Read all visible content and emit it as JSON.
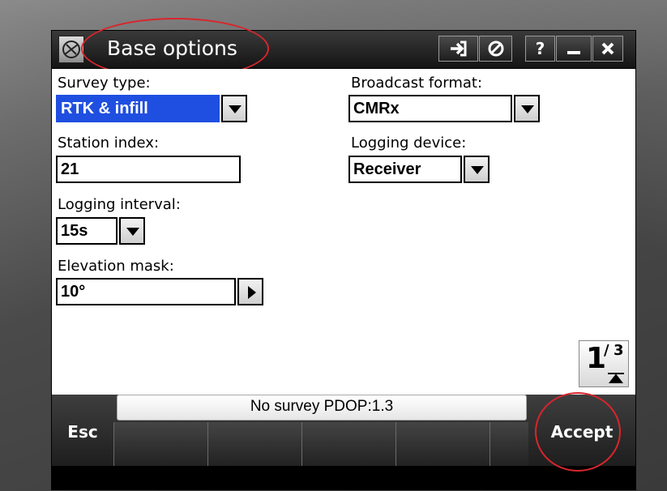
{
  "window": {
    "title": "Base options"
  },
  "titlebar_buttons": {
    "help_label": "?"
  },
  "form": {
    "survey_type": {
      "label": "Survey type:",
      "value": "RTK & infill"
    },
    "station_index": {
      "label": "Station index:",
      "value": "21"
    },
    "logging_interval": {
      "label": "Logging interval:",
      "value": "15s"
    },
    "elevation_mask": {
      "label": "Elevation mask:",
      "value": "10°"
    },
    "broadcast_format": {
      "label": "Broadcast format:",
      "value": "CMRx"
    },
    "logging_device": {
      "label": "Logging device:",
      "value": "Receiver"
    }
  },
  "page_indicator": {
    "current": "1",
    "total": "3"
  },
  "status": {
    "text": "No survey  PDOP:1.3"
  },
  "softkeys": {
    "esc_label": "Esc",
    "accept_label": "Accept"
  },
  "colors": {
    "selection": "#1f4fe0",
    "annotation": "#d8262c"
  }
}
